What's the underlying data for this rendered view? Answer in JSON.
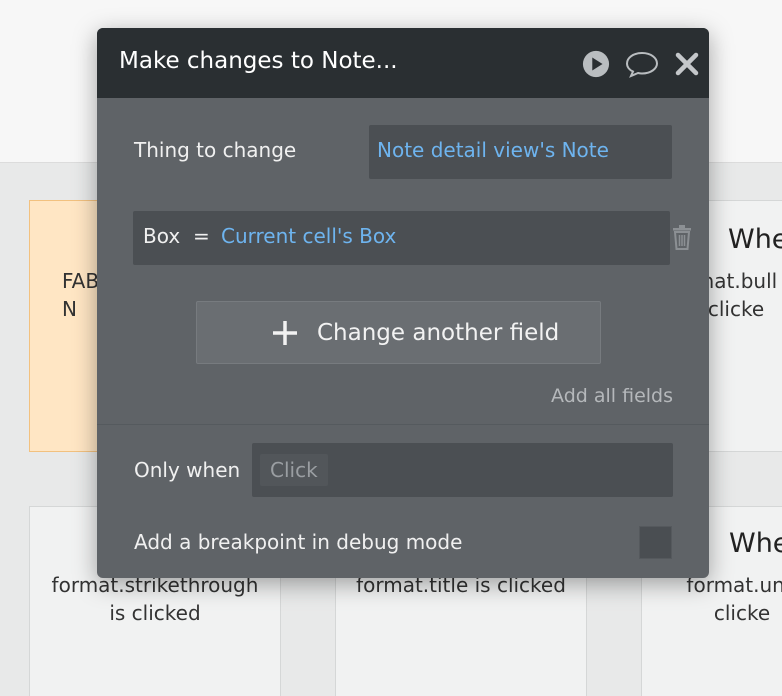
{
  "background_cards": {
    "c1_text": "FAB\nN",
    "c2_title": "Whe",
    "c2_text": "mat.bull\nclicke",
    "c3_text": "format.strikethrough\nis clicked",
    "c4_text": "format.title is clicked",
    "c5_title": "Whe",
    "c5_text": "format.und\nclicke"
  },
  "panel": {
    "title": "Make changes to Note...",
    "icons": {
      "play": "play-icon",
      "comment": "comment-icon",
      "close": "close-icon"
    },
    "thing_to_change": {
      "label": "Thing to change",
      "value": "Note detail view's Note"
    },
    "field_row": {
      "key": "Box",
      "operator": "=",
      "value": "Current cell's Box",
      "delete_icon": "trash-icon"
    },
    "change_another_label": "Change another field",
    "add_all_fields_label": "Add all fields",
    "only_when": {
      "label": "Only when",
      "placeholder": "Click"
    },
    "breakpoint": {
      "label": "Add a breakpoint in debug mode",
      "checked": false
    }
  },
  "colors": {
    "panel_bg": "#5f6367",
    "header_bg": "#2a2f32",
    "accent_blue": "#6eb4ef",
    "card_orange": "#ffe6c4"
  }
}
